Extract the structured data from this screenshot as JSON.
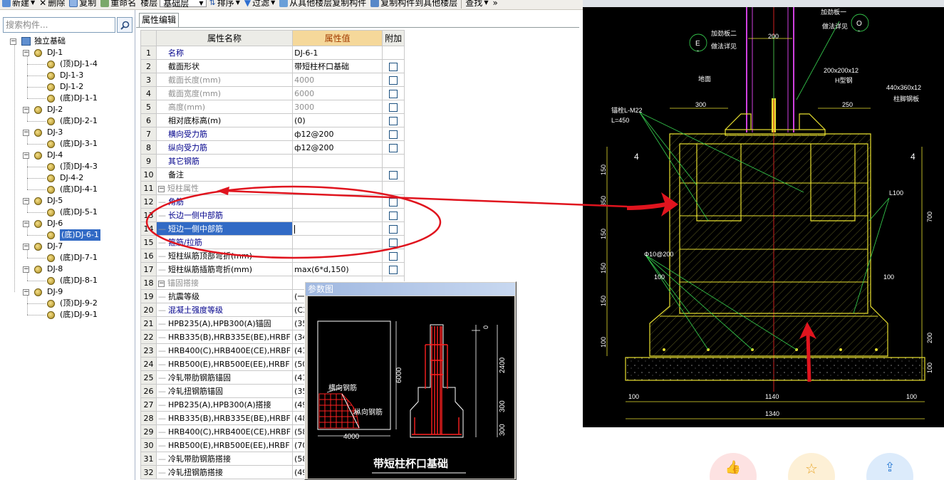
{
  "toolbar": {
    "new": "新建",
    "delete": "删除",
    "copy": "复制",
    "rename": "重命名",
    "floor_label": "楼层",
    "floor_value": "基础层",
    "sort": "排序",
    "filter": "过滤",
    "copy_from_floor": "从其他楼层复制构件",
    "copy_to_floor": "复制构件到其他楼层",
    "find": "查找",
    "overflow": "»"
  },
  "search": {
    "placeholder": "搜索构件..."
  },
  "tree": {
    "root": "独立基础",
    "groups": [
      {
        "name": "DJ-1",
        "children": [
          "(顶)DJ-1-4",
          "DJ-1-3",
          "DJ-1-2",
          "(底)DJ-1-1"
        ]
      },
      {
        "name": "DJ-2",
        "children": [
          "(底)DJ-2-1"
        ]
      },
      {
        "name": "DJ-3",
        "children": [
          "(底)DJ-3-1"
        ]
      },
      {
        "name": "DJ-4",
        "children": [
          "(顶)DJ-4-3",
          "DJ-4-2",
          "(底)DJ-4-1"
        ]
      },
      {
        "name": "DJ-5",
        "children": [
          "(底)DJ-5-1"
        ]
      },
      {
        "name": "DJ-6",
        "children": [
          "(底)DJ-6-1"
        ]
      },
      {
        "name": "DJ-7",
        "children": [
          "(底)DJ-7-1"
        ]
      },
      {
        "name": "DJ-8",
        "children": [
          "(底)DJ-8-1"
        ]
      },
      {
        "name": "DJ-9",
        "children": [
          "(顶)DJ-9-2",
          "(底)DJ-9-1"
        ]
      }
    ],
    "selected": "(底)DJ-6-1"
  },
  "props": {
    "tab": "属性编辑",
    "headers": {
      "name": "属性名称",
      "value": "属性值",
      "extra": "附加"
    },
    "rows": [
      {
        "n": "1",
        "name": "名称",
        "value": "DJ-6-1",
        "color": "blue",
        "check": false,
        "indent": 0
      },
      {
        "n": "2",
        "name": "截面形状",
        "value": "带短柱杯口基础",
        "color": "black",
        "check": true,
        "indent": 0
      },
      {
        "n": "3",
        "name": "截面长度(mm)",
        "value": "4000",
        "color": "gray",
        "check": true,
        "indent": 0
      },
      {
        "n": "4",
        "name": "截面宽度(mm)",
        "value": "6000",
        "color": "gray",
        "check": true,
        "indent": 0
      },
      {
        "n": "5",
        "name": "高度(mm)",
        "value": "3000",
        "color": "gray",
        "check": true,
        "indent": 0
      },
      {
        "n": "6",
        "name": "相对底标高(m)",
        "value": "(0)",
        "color": "black",
        "check": true,
        "indent": 0
      },
      {
        "n": "7",
        "name": "横向受力筋",
        "value": "ф12@200",
        "color": "blue",
        "check": true,
        "indent": 0
      },
      {
        "n": "8",
        "name": "纵向受力筋",
        "value": "ф12@200",
        "color": "blue",
        "check": true,
        "indent": 0
      },
      {
        "n": "9",
        "name": "其它钢筋",
        "value": "",
        "color": "blue",
        "check": false,
        "indent": 0
      },
      {
        "n": "10",
        "name": "备注",
        "value": "",
        "color": "black",
        "check": true,
        "indent": 0
      },
      {
        "n": "11",
        "name": "短柱属性",
        "value": "",
        "color": "gray",
        "check": false,
        "indent": 0,
        "group": true
      },
      {
        "n": "12",
        "name": "角筋",
        "value": "",
        "color": "blue",
        "check": true,
        "indent": 1
      },
      {
        "n": "13",
        "name": "长边一侧中部筋",
        "value": "",
        "color": "blue",
        "check": true,
        "indent": 1
      },
      {
        "n": "14",
        "name": "短边一侧中部筋",
        "value": "",
        "color": "blue",
        "check": true,
        "indent": 1,
        "selected": true
      },
      {
        "n": "15",
        "name": "箍筋/拉筋",
        "value": "",
        "color": "blue",
        "check": true,
        "indent": 1
      },
      {
        "n": "16",
        "name": "短柱纵筋顶部弯折(mm)",
        "value": "",
        "color": "black",
        "check": true,
        "indent": 1
      },
      {
        "n": "17",
        "name": "短柱纵筋插筋弯折(mm)",
        "value": "max(6*d,150)",
        "color": "black",
        "check": true,
        "indent": 1
      },
      {
        "n": "18",
        "name": "锚固搭接",
        "value": "",
        "color": "gray",
        "check": false,
        "indent": 0,
        "group": true
      },
      {
        "n": "19",
        "name": "抗震等级",
        "value": "(一",
        "color": "black",
        "check": false,
        "indent": 1
      },
      {
        "n": "20",
        "name": "混凝土强度等级",
        "value": "(C3",
        "color": "blue",
        "check": false,
        "indent": 1
      },
      {
        "n": "21",
        "name": "HPB235(A),HPB300(A)锚固",
        "value": "(35",
        "color": "black",
        "check": false,
        "indent": 1
      },
      {
        "n": "22",
        "name": "HRB335(B),HRB335E(BE),HRBF",
        "value": "(34",
        "color": "black",
        "check": false,
        "indent": 1
      },
      {
        "n": "23",
        "name": "HRB400(C),HRB400E(CE),HRBF",
        "value": "(41",
        "color": "black",
        "check": false,
        "indent": 1
      },
      {
        "n": "24",
        "name": "HRB500(E),HRB500E(EE),HRBF",
        "value": "(50",
        "color": "black",
        "check": false,
        "indent": 1
      },
      {
        "n": "25",
        "name": "冷轧带肋钢筋锚固",
        "value": "(41",
        "color": "black",
        "check": false,
        "indent": 1
      },
      {
        "n": "26",
        "name": "冷轧扭钢筋锚固",
        "value": "(35",
        "color": "black",
        "check": false,
        "indent": 1
      },
      {
        "n": "27",
        "name": "HPB235(A),HPB300(A)搭接",
        "value": "(49",
        "color": "black",
        "check": false,
        "indent": 1
      },
      {
        "n": "28",
        "name": "HRB335(B),HRB335E(BE),HRBF",
        "value": "(48",
        "color": "black",
        "check": false,
        "indent": 1
      },
      {
        "n": "29",
        "name": "HRB400(C),HRB400E(CE),HRBF",
        "value": "(58",
        "color": "black",
        "check": false,
        "indent": 1
      },
      {
        "n": "30",
        "name": "HRB500(E),HRB500E(EE),HRBF",
        "value": "(70",
        "color": "black",
        "check": false,
        "indent": 1
      },
      {
        "n": "31",
        "name": "冷轧带肋钢筋搭接",
        "value": "(58",
        "color": "black",
        "check": false,
        "indent": 1
      },
      {
        "n": "32",
        "name": "冷轧扭钢筋搭接",
        "value": "(49",
        "color": "black",
        "check": false,
        "indent": 1
      }
    ]
  },
  "param": {
    "title": "参数图",
    "dim_6000": "6000",
    "dim_4000": "4000",
    "label_transverse": "横向钢筋",
    "label_longitudinal": "纵向钢筋",
    "dim_0": "0",
    "dim_2400": "2400",
    "dim_300a": "300",
    "dim_300b": "300",
    "caption": "带短柱杯口基础"
  },
  "cad": {
    "labels": {
      "joint2": "加劲板二",
      "detail": "做法详见",
      "joint1": "加劲板一",
      "ground": "地面",
      "steel1": "200x200x12",
      "steel2": "H型钢",
      "plate1": "440x360x12",
      "plate2": "柱脚钢板",
      "bolt1": "锚栓L-M22",
      "bolt2": "L=450",
      "rebar": "Φ10@200",
      "l100": "L100",
      "e": "E",
      "o": "O",
      "dash1": "-",
      "dash2": "-",
      "four_l": "4",
      "four_r": "4"
    },
    "dims": {
      "d200": "200",
      "d300": "300",
      "d250": "250",
      "v150a": "150",
      "v350": "350",
      "v150b": "150",
      "v150c": "150",
      "v150d": "150",
      "v100": "100",
      "r700": "700",
      "r200": "200",
      "r100": "100",
      "b100a": "100",
      "b1140": "1140",
      "b100b": "100",
      "b1340": "1340",
      "i100a": "100",
      "i100b": "100"
    }
  },
  "colors": {
    "annotation_red": "#e0141e",
    "cad_yellow": "#e8e030",
    "cad_green": "#33c24a",
    "cad_magenta": "#c040e0",
    "selection_blue": "#316ac5",
    "header_orange": "#f5d89a"
  }
}
